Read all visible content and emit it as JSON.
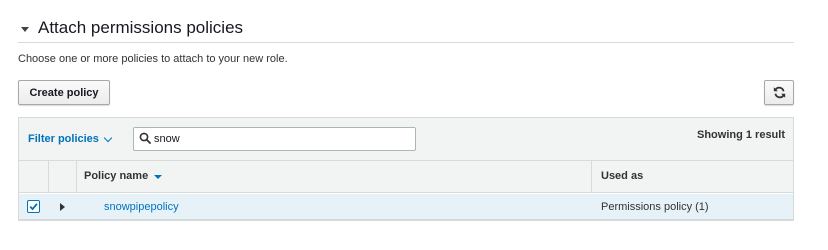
{
  "section": {
    "title": "Attach permissions policies",
    "description": "Choose one or more policies to attach to your new role."
  },
  "toolbar": {
    "create_policy_label": "Create policy",
    "refresh_icon": "refresh-icon"
  },
  "filter": {
    "label": "Filter policies",
    "search_value": "snow",
    "result_count": "Showing 1 result"
  },
  "table": {
    "columns": [
      "Policy name",
      "Used as"
    ],
    "sort_column": "Policy name",
    "sort_direction": "descending",
    "rows": [
      {
        "checked": true,
        "policy_name": "snowpipepolicy",
        "used_as": "Permissions policy (1)"
      }
    ]
  },
  "colors": {
    "accent": "#0073bb",
    "selected_row": "#e6f2f8",
    "header_bg": "#f2f3f3",
    "border": "#d5dbdb"
  }
}
